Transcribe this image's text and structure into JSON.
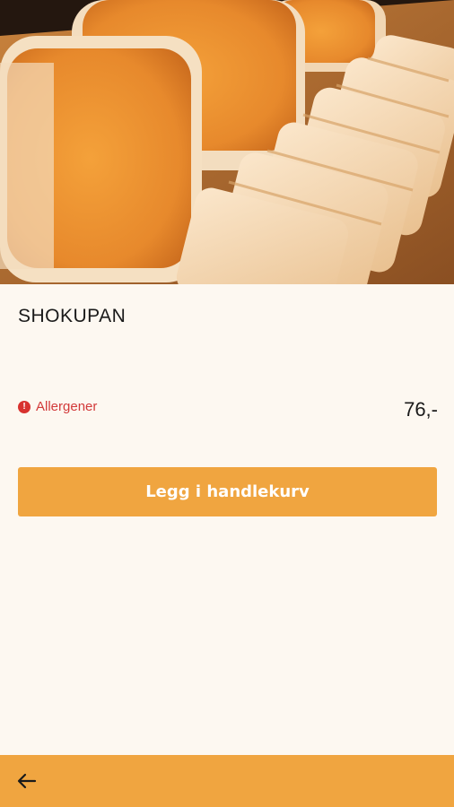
{
  "product": {
    "image_alt": "shokupan bread loaves on wooden board",
    "name": "SHOKUPAN",
    "allergen_label": "Allergener",
    "allergen_icon": "warning-icon",
    "price": "76,-"
  },
  "actions": {
    "add_to_cart_label": "Legg i handlekurv"
  },
  "nav": {
    "back_icon": "arrow-left-icon"
  },
  "colors": {
    "accent": "#f0a540",
    "background": "#fdf8f1",
    "allergen": "#d23a3a"
  }
}
